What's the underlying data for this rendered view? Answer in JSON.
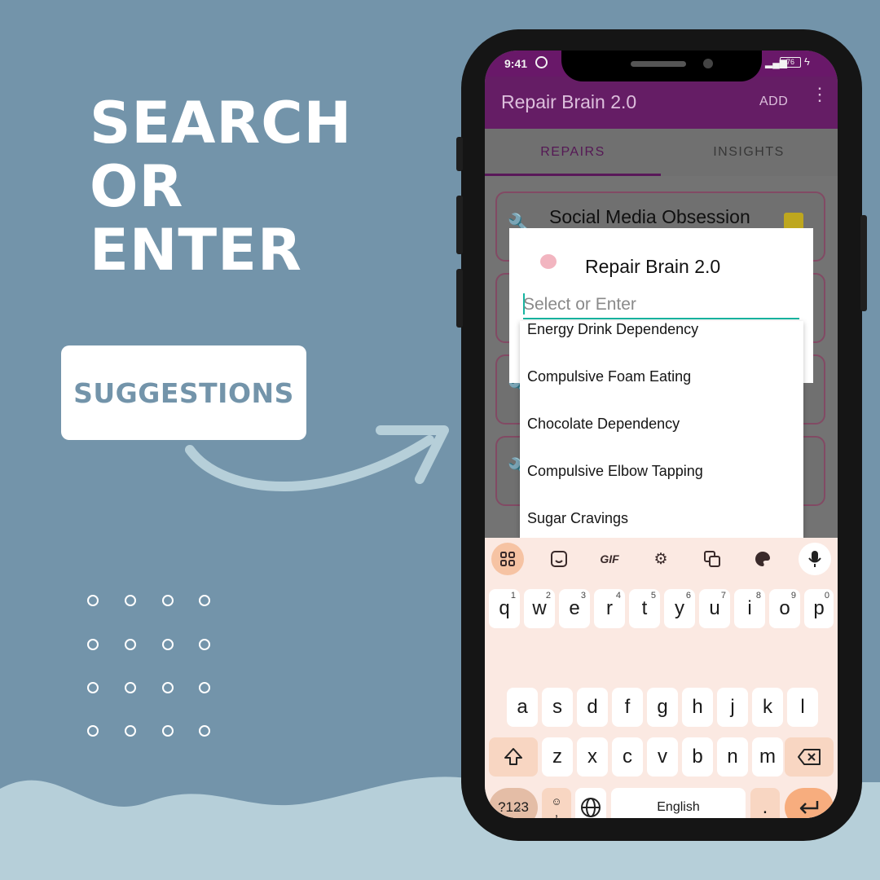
{
  "promo": {
    "headline": [
      "SEARCH",
      "OR",
      "ENTER"
    ],
    "tag": "SUGGESTIONS"
  },
  "status_bar": {
    "time": "9:41",
    "battery": "76"
  },
  "app_bar": {
    "title": "Repair Brain 2.0",
    "add_label": "ADD",
    "more_icon": "more-vert-icon"
  },
  "tabs": [
    {
      "label": "REPAIRS",
      "active": true
    },
    {
      "label": "INSIGHTS",
      "active": false
    }
  ],
  "cards": [
    {
      "title": "Social Media Obsession"
    }
  ],
  "dialog": {
    "title": "Repair Brain 2.0",
    "input_placeholder": "Select or Enter",
    "suggestions": [
      "Energy Drink Dependency",
      "Compulsive Foam Eating",
      "Chocolate Dependency",
      "Compulsive Elbow Tapping",
      "Sugar Cravings"
    ]
  },
  "keyboard": {
    "toolbar": {
      "gif_label": "GIF"
    },
    "row1": [
      "q",
      "w",
      "e",
      "r",
      "t",
      "y",
      "u",
      "i",
      "o",
      "p"
    ],
    "row1_hints": [
      "1",
      "2",
      "3",
      "4",
      "5",
      "6",
      "7",
      "8",
      "9",
      "0"
    ],
    "row2": [
      "a",
      "s",
      "d",
      "f",
      "g",
      "h",
      "j",
      "k",
      "l"
    ],
    "row3": [
      "z",
      "x",
      "c",
      "v",
      "b",
      "n",
      "m"
    ],
    "symbols_label": "?123",
    "comma_label": ",",
    "space_label": "English",
    "period_label": "."
  },
  "colors": {
    "background": "#7394aa",
    "app_bar": "#6b1f6b",
    "accent": "#16b4a0",
    "keyboard": "#fbe9e2",
    "enter_key": "#f7ad7e"
  }
}
